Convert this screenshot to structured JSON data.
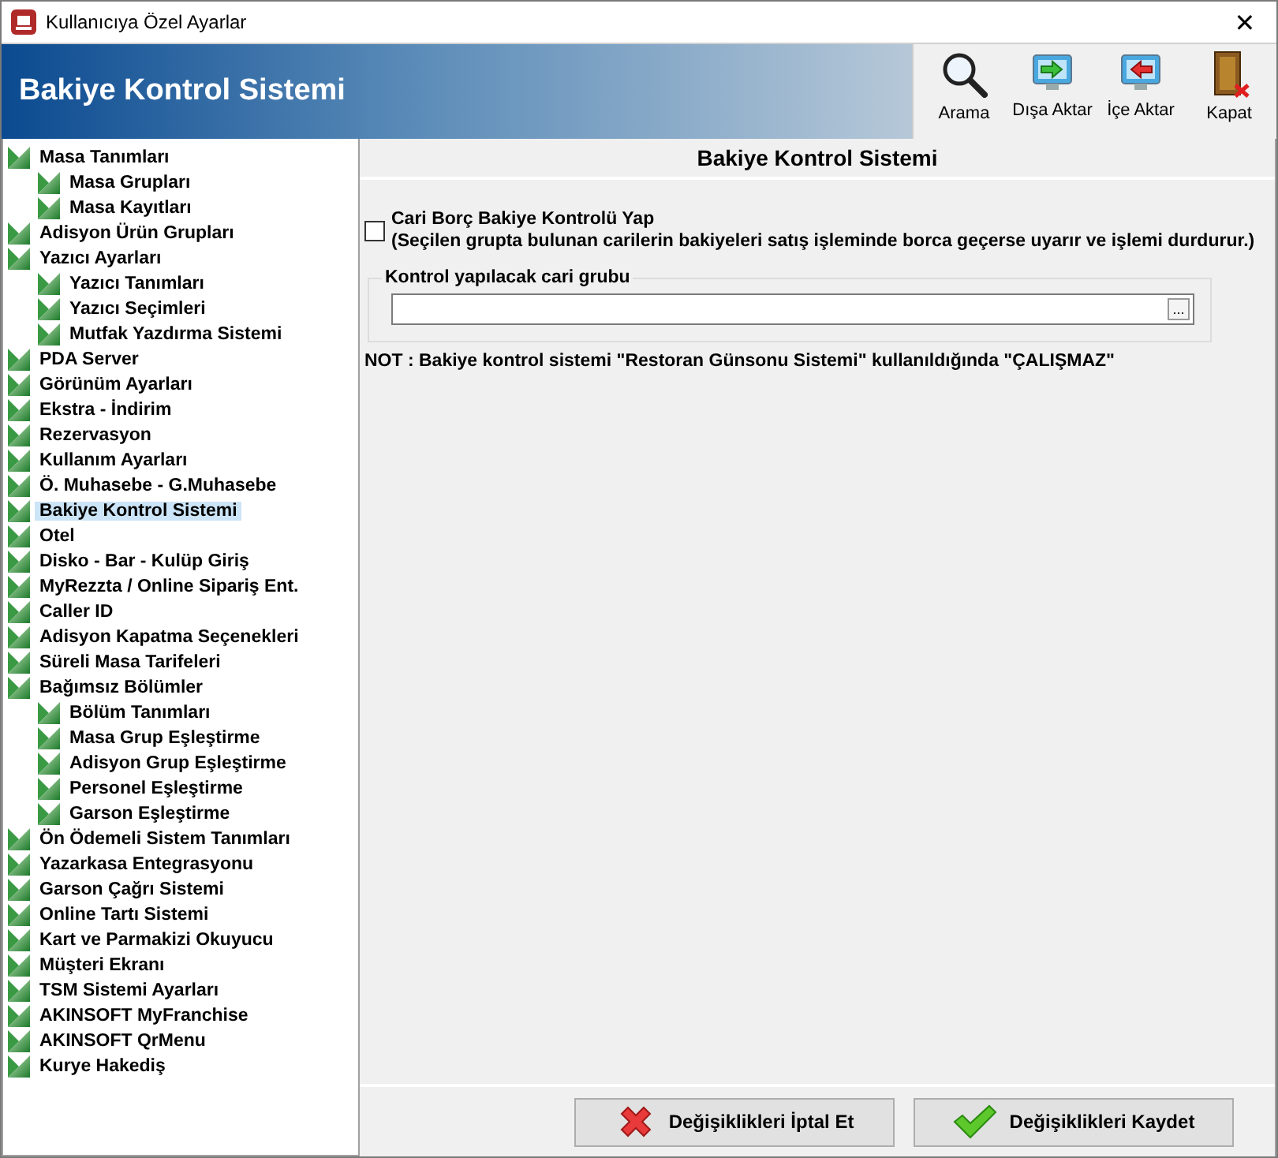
{
  "window": {
    "title": "Kullanıcıya Özel Ayarlar",
    "close": "✕"
  },
  "header": {
    "title": "Bakiye Kontrol Sistemi"
  },
  "toolbar": [
    {
      "kind": "search",
      "label": "Arama"
    },
    {
      "kind": "export",
      "label": "Dışa Aktar"
    },
    {
      "kind": "import",
      "label": "İçe Aktar"
    },
    {
      "kind": "exit",
      "label": "Kapat"
    }
  ],
  "tree": [
    {
      "label": "Masa Tanımları",
      "selected": false,
      "children": [
        {
          "label": "Masa Grupları",
          "selected": false
        },
        {
          "label": "Masa Kayıtları",
          "selected": false
        }
      ]
    },
    {
      "label": "Adisyon Ürün Grupları",
      "selected": false
    },
    {
      "label": "Yazıcı Ayarları",
      "selected": false,
      "children": [
        {
          "label": "Yazıcı Tanımları",
          "selected": false
        },
        {
          "label": "Yazıcı Seçimleri",
          "selected": false
        },
        {
          "label": "Mutfak Yazdırma Sistemi",
          "selected": false
        }
      ]
    },
    {
      "label": "PDA Server",
      "selected": false
    },
    {
      "label": "Görünüm Ayarları",
      "selected": false
    },
    {
      "label": "Ekstra - İndirim",
      "selected": false
    },
    {
      "label": "Rezervasyon",
      "selected": false
    },
    {
      "label": "Kullanım Ayarları",
      "selected": false
    },
    {
      "label": "Ö. Muhasebe - G.Muhasebe",
      "selected": false
    },
    {
      "label": "Bakiye Kontrol Sistemi",
      "selected": true
    },
    {
      "label": "Otel",
      "selected": false
    },
    {
      "label": "Disko - Bar - Kulüp Giriş",
      "selected": false
    },
    {
      "label": "MyRezzta / Online Sipariş Ent.",
      "selected": false
    },
    {
      "label": "Caller ID",
      "selected": false
    },
    {
      "label": "Adisyon Kapatma Seçenekleri",
      "selected": false
    },
    {
      "label": "Süreli Masa Tarifeleri",
      "selected": false
    },
    {
      "label": "Bağımsız Bölümler",
      "selected": false,
      "children": [
        {
          "label": "Bölüm Tanımları",
          "selected": false
        },
        {
          "label": "Masa Grup Eşleştirme",
          "selected": false
        },
        {
          "label": "Adisyon Grup Eşleştirme",
          "selected": false
        },
        {
          "label": "Personel Eşleştirme",
          "selected": false
        },
        {
          "label": "Garson Eşleştirme",
          "selected": false
        }
      ]
    },
    {
      "label": "Ön Ödemeli Sistem Tanımları",
      "selected": false
    },
    {
      "label": "Yazarkasa Entegrasyonu",
      "selected": false
    },
    {
      "label": "Garson Çağrı Sistemi",
      "selected": false
    },
    {
      "label": "Online Tartı Sistemi",
      "selected": false
    },
    {
      "label": "Kart ve Parmakizi Okuyucu",
      "selected": false
    },
    {
      "label": "Müşteri Ekranı",
      "selected": false
    },
    {
      "label": "TSM Sistemi Ayarları",
      "selected": false
    },
    {
      "label": "AKINSOFT MyFranchise",
      "selected": false
    },
    {
      "label": "AKINSOFT QrMenu",
      "selected": false
    },
    {
      "label": "Kurye Hakediş",
      "selected": false
    }
  ],
  "panel": {
    "title": "Bakiye Kontrol Sistemi",
    "checkbox": {
      "label": "Cari Borç Bakiye Kontrolü Yap",
      "description": "(Seçilen grupta bulunan carilerin bakiyeleri satış işleminde borca geçerse uyarır ve işlemi durdurur.)",
      "checked": false
    },
    "group": {
      "title": "Kontrol yapılacak cari grubu",
      "browse": "..."
    },
    "note": "NOT : Bakiye kontrol sistemi  \"Restoran Günsonu Sistemi\" kullanıldığında \"ÇALIŞMAZ\""
  },
  "buttons": [
    {
      "kind": "cancel",
      "label": "Değişiklikleri İptal Et"
    },
    {
      "kind": "save",
      "label": "Değişiklikleri Kaydet"
    }
  ]
}
